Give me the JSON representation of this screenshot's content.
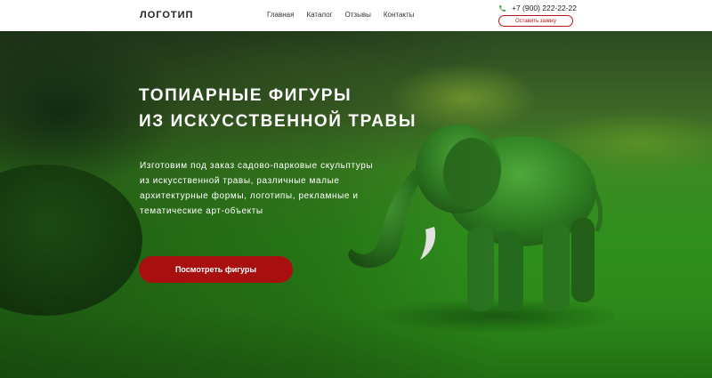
{
  "header": {
    "logo": "ЛОГОТИП",
    "nav": [
      "Главная",
      "Каталог",
      "Отзывы",
      "Контакты"
    ],
    "phone": "+7 (900) 222-22-22",
    "callback_label": "Оставить заявку"
  },
  "hero": {
    "title_line1": "ТОПИАРНЫЕ ФИГУРЫ",
    "title_line2": "ИЗ ИСКУССТВЕННОЙ ТРАВЫ",
    "desc_lines": [
      "Изготовим под заказ садово-парковые скульптуры",
      "из искусственной травы, различные малые",
      "архитектурные формы, логотипы, рекламные и",
      "тематические арт-объекты"
    ],
    "cta_label": "Посмотреть фигуры"
  },
  "colors": {
    "accent_red": "#a80f0f",
    "phone_icon_green": "#2e9d3a",
    "grass_green": "#2d8a1a"
  },
  "icons": {
    "phone": "phone-icon"
  }
}
